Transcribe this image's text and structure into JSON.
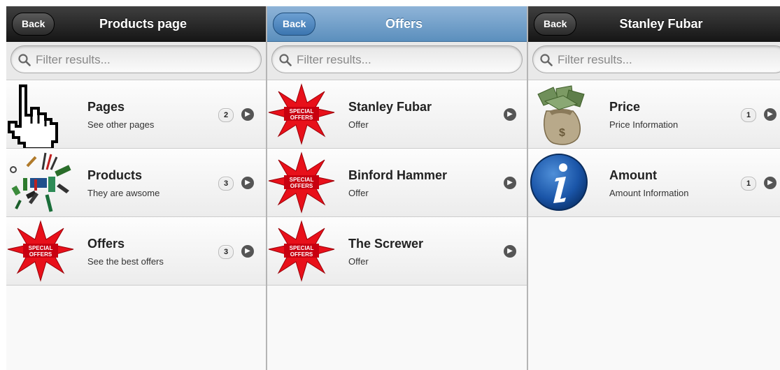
{
  "screens": [
    {
      "back_label": "Back",
      "title": "Products page",
      "filter_placeholder": "Filter results...",
      "items": [
        {
          "title": "Pages",
          "subtitle": "See other pages",
          "count": "2",
          "icon": "hand-pointer-icon"
        },
        {
          "title": "Products",
          "subtitle": "They are awsome",
          "count": "3",
          "icon": "tools-icon"
        },
        {
          "title": "Offers",
          "subtitle": "See the best offers",
          "count": "3",
          "icon": "special-offers-icon"
        }
      ]
    },
    {
      "back_label": "Back",
      "title": "Offers",
      "filter_placeholder": "Filter results...",
      "items": [
        {
          "title": "Stanley Fubar",
          "subtitle": "Offer",
          "icon": "special-offers-icon"
        },
        {
          "title": "Binford Hammer",
          "subtitle": "Offer",
          "icon": "special-offers-icon"
        },
        {
          "title": "The Screwer",
          "subtitle": "Offer",
          "icon": "special-offers-icon"
        }
      ]
    },
    {
      "back_label": "Back",
      "title": "Stanley Fubar",
      "filter_placeholder": "Filter results...",
      "items": [
        {
          "title": "Price",
          "subtitle": "Price Information",
          "count": "1",
          "icon": "money-bag-icon"
        },
        {
          "title": "Amount",
          "subtitle": "Amount Information",
          "count": "1",
          "icon": "info-icon"
        }
      ]
    }
  ],
  "badge_text": [
    "SPECIAL",
    "OFFERS"
  ],
  "colors": {
    "header_dark": "#222222",
    "header_blue": "#6d9bc8",
    "star_red": "#e8101a"
  }
}
